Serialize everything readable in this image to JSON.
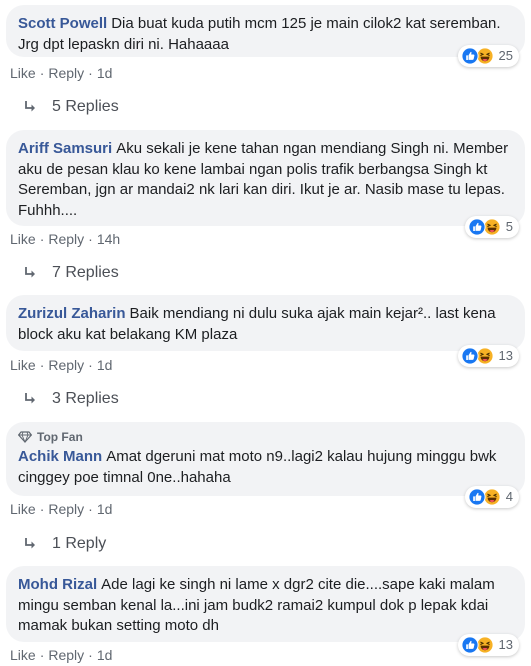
{
  "comments": [
    {
      "author": "Scott Powell",
      "text": "Dia buat kuda putih mcm 125 je main cilok2 kat seremban. Jrg dpt lepaskn diri ni. Hahaaaa",
      "like": "Like",
      "reply": "Reply",
      "time": "1d",
      "reaction_count": "25",
      "replies_label": "5 Replies",
      "badge": ""
    },
    {
      "author": "Ariff Samsuri",
      "text": "Aku sekali je kene tahan ngan mendiang Singh ni. Member aku de pesan klau ko kene lambai ngan polis trafik berbangsa Singh kt Seremban, jgn ar mandai2 nk lari kan diri. Ikut je ar. Nasib mase tu lepas. Fuhhh....",
      "like": "Like",
      "reply": "Reply",
      "time": "14h",
      "reaction_count": "5",
      "replies_label": "7 Replies",
      "badge": ""
    },
    {
      "author": "Zurizul Zaharin",
      "text": "Baik mendiang ni dulu suka ajak main kejar².. last kena block aku kat belakang KM plaza",
      "like": "Like",
      "reply": "Reply",
      "time": "1d",
      "reaction_count": "13",
      "replies_label": "3 Replies",
      "badge": ""
    },
    {
      "author": "Achik Mann",
      "text": "Amat dgeruni mat moto n9..lagi2 kalau hujung minggu bwk cinggey poe timnal 0ne..hahaha",
      "like": "Like",
      "reply": "Reply",
      "time": "1d",
      "reaction_count": "4",
      "replies_label": "1 Reply",
      "badge": "Top Fan"
    },
    {
      "author": "Mohd Rizal",
      "text": "Ade lagi ke singh ni lame x dgr2 cite die....sape kaki malam mingu semban kenal la...ini jam budk2 ramai2 kumpul dok p lepak kdai mamak bukan setting moto dh",
      "like": "Like",
      "reply": "Reply",
      "time": "1d",
      "reaction_count": "13",
      "replies_label": "",
      "badge": ""
    }
  ],
  "separator": "·",
  "colors": {
    "author": "#385898",
    "bubble": "#f2f3f5",
    "meta": "#606770",
    "like_blue": "#1877f2",
    "haha_yellow": "#f7b125"
  }
}
